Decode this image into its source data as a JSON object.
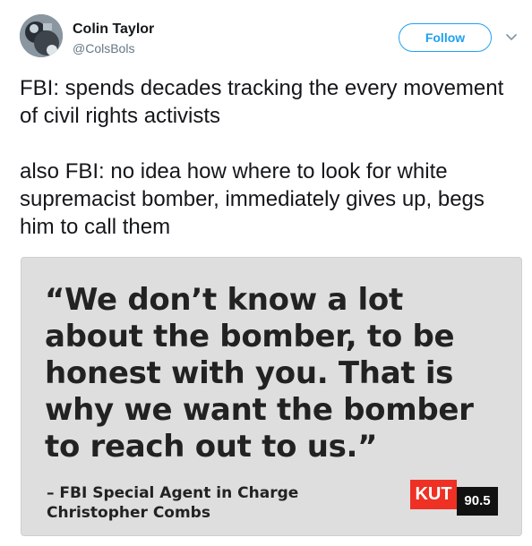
{
  "author": {
    "name": "Colin Taylor",
    "handle": "@ColsBols",
    "avatar_icon": "profile-photo"
  },
  "actions": {
    "follow_label": "Follow",
    "more_icon": "chevron-down-icon"
  },
  "tweet": {
    "paragraphs": [
      "FBI: spends decades tracking the every movement of civil rights activists",
      "also FBI: no idea how where to look for white supremacist bomber, immediately gives up, begs him to call them"
    ]
  },
  "card": {
    "quote": "“We don’t know a lot about the bomber, to be honest with you. That is why we want the bomber to reach out to us.”",
    "attribution_line1": "– FBI Special Agent in Charge",
    "attribution_line2": "Christopher Combs",
    "logo_station": "KUT",
    "logo_frequency": "90.5"
  },
  "colors": {
    "follow_blue": "#1da1f2",
    "card_background": "#dedede",
    "logo_red": "#ee3124"
  }
}
